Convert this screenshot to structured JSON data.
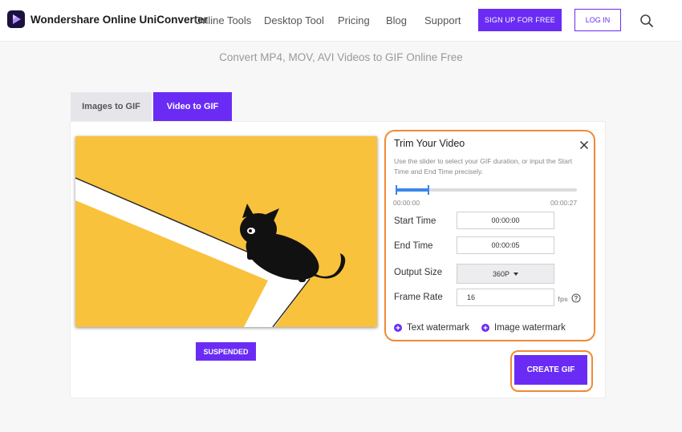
{
  "header": {
    "brand": "Wondershare Online UniConverter",
    "nav": [
      "Online Tools",
      "Desktop Tool",
      "Pricing",
      "Blog",
      "Support"
    ],
    "signup_label": "SIGN UP FOR FREE",
    "login_label": "LOG IN"
  },
  "page": {
    "subtitle": "Convert MP4, MOV, AVI Videos to GIF Online Free"
  },
  "tabs": [
    {
      "label": "Images to GIF",
      "active": false
    },
    {
      "label": "Video to GIF",
      "active": true
    }
  ],
  "video": {
    "suspended_label": "SUSPENDED"
  },
  "trim": {
    "title": "Trim Your Video",
    "description": "Use the slider to select your GIF duration, or input the Start Time and End Time precisely.",
    "slider_start_label": "00:00:00",
    "slider_end_label": "00:00:27",
    "selection_start_seconds": 0,
    "selection_end_seconds": 5,
    "total_seconds": 27,
    "start_time_label": "Start Time",
    "start_time_value": "00:00:00",
    "end_time_label": "End Time",
    "end_time_value": "00:00:05",
    "output_size_label": "Output Size",
    "output_size_value": "360P",
    "frame_rate_label": "Frame Rate",
    "frame_rate_value": "16",
    "fps_unit": "fps",
    "text_watermark_label": "Text watermark",
    "image_watermark_label": "Image watermark"
  },
  "actions": {
    "create_label": "CREATE GIF"
  },
  "colors": {
    "accent": "#6a2cf5",
    "highlight": "#f08a35",
    "slider": "#3a86e8",
    "video_bg": "#f9c23c"
  }
}
